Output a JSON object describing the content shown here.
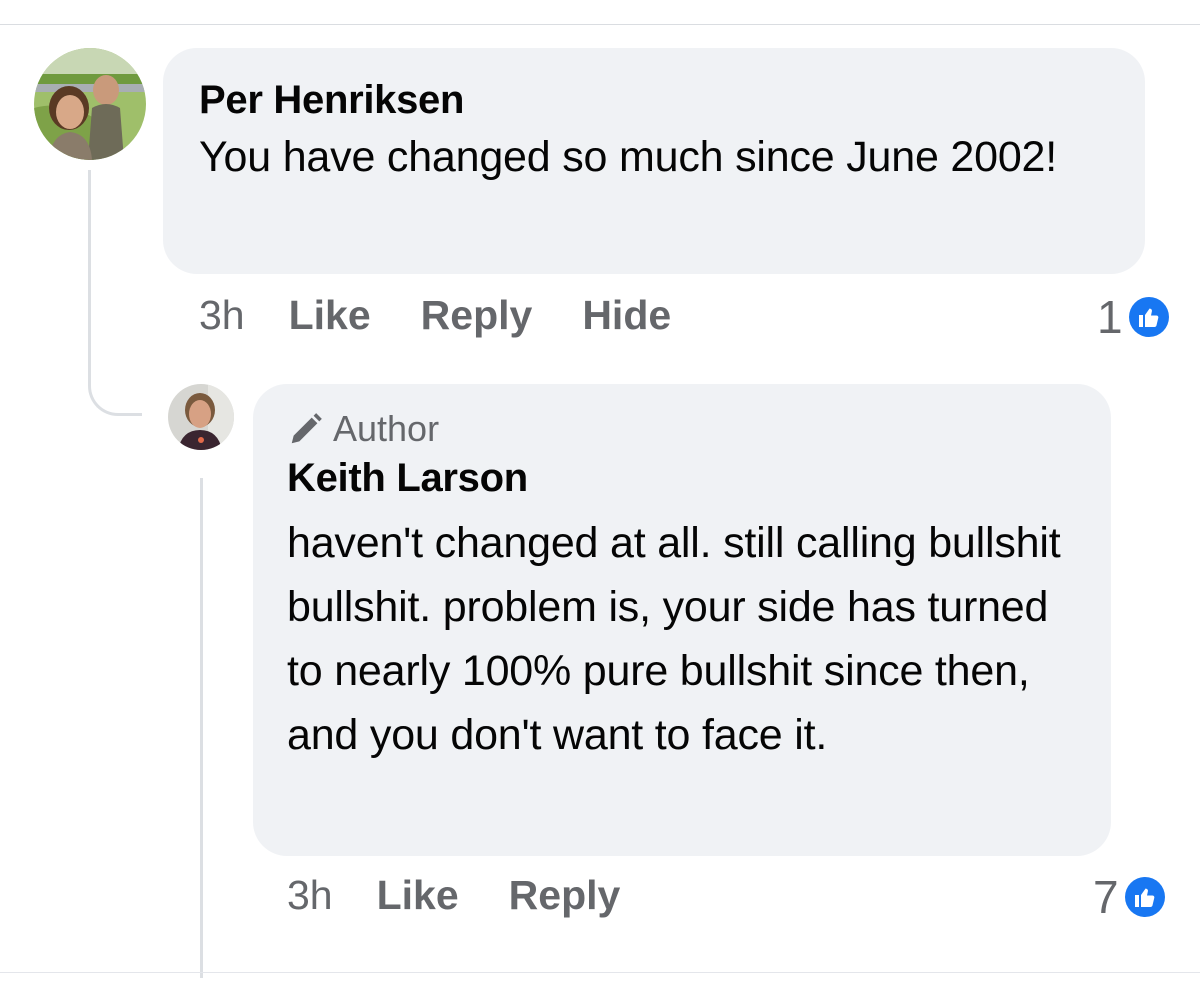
{
  "comment": {
    "author_name": "Per Henriksen",
    "text": "You have changed so much since June 2002!",
    "time": "3h",
    "like_label": "Like",
    "reply_label": "Reply",
    "hide_label": "Hide",
    "reaction_count": "1",
    "reaction_icon": "thumbs-up-icon"
  },
  "reply": {
    "badge_label": "Author",
    "badge_icon": "pencil-icon",
    "author_name": "Keith Larson",
    "text": "haven't changed at all. still calling bullshit bullshit. problem is, your side has turned to nearly 100% pure bullshit since then, and you don't want to face it.",
    "time": "3h",
    "like_label": "Like",
    "reply_label": "Reply",
    "reaction_count": "7",
    "reaction_icon": "thumbs-up-icon"
  },
  "colors": {
    "like_blue": "#1877f2",
    "bubble_bg": "#f0f2f5",
    "secondary_text": "#65676b"
  }
}
